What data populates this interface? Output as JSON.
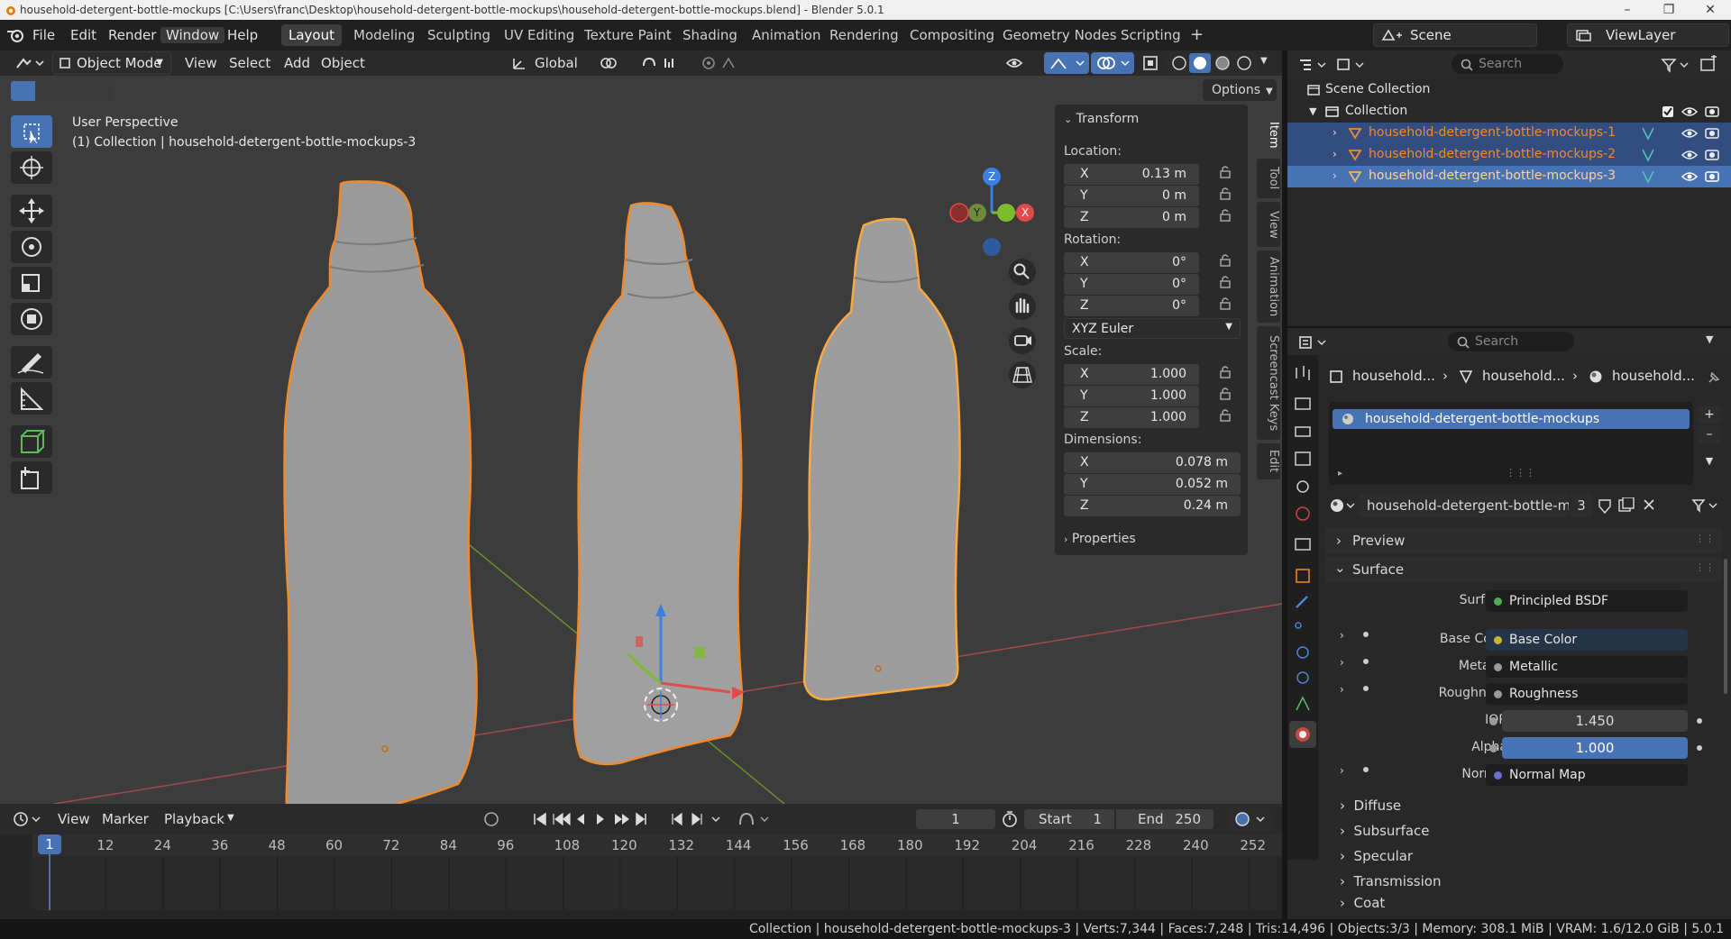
{
  "window": {
    "title": "household-detergent-bottle-mockups [C:\\Users\\franc\\Desktop\\household-detergent-bottle-mockups\\household-detergent-bottle-mockups.blend] - Blender 5.0.1"
  },
  "menu": [
    "File",
    "Edit",
    "Render",
    "Window",
    "Help"
  ],
  "workspaces": [
    {
      "label": "Layout",
      "active": true
    },
    {
      "label": "Modeling"
    },
    {
      "label": "Sculpting"
    },
    {
      "label": "UV Editing"
    },
    {
      "label": "Texture Paint"
    },
    {
      "label": "Shading"
    },
    {
      "label": "Animation"
    },
    {
      "label": "Rendering"
    },
    {
      "label": "Compositing"
    },
    {
      "label": "Geometry Nodes"
    },
    {
      "label": "Scripting"
    }
  ],
  "scene": {
    "name": "Scene",
    "view_layer": "ViewLayer"
  },
  "viewport_header": {
    "mode": "Object Mode",
    "menus": [
      "View",
      "Select",
      "Add",
      "Object"
    ],
    "orientation": "Global",
    "options": "Options"
  },
  "viewport": {
    "perspective": "User Perspective",
    "collection_info": "(1) Collection | household-detergent-bottle-mockups-3",
    "gizmo_axes": [
      "X",
      "Y",
      "Z"
    ]
  },
  "transform": {
    "title": "Transform",
    "location_label": "Location:",
    "location": [
      {
        "axis": "X",
        "value": "0.13 m"
      },
      {
        "axis": "Y",
        "value": "0 m"
      },
      {
        "axis": "Z",
        "value": "0 m"
      }
    ],
    "rotation_label": "Rotation:",
    "rotation": [
      {
        "axis": "X",
        "value": "0°"
      },
      {
        "axis": "Y",
        "value": "0°"
      },
      {
        "axis": "Z",
        "value": "0°"
      }
    ],
    "rotation_mode": "XYZ Euler",
    "scale_label": "Scale:",
    "scale": [
      {
        "axis": "X",
        "value": "1.000"
      },
      {
        "axis": "Y",
        "value": "1.000"
      },
      {
        "axis": "Z",
        "value": "1.000"
      }
    ],
    "dimensions_label": "Dimensions:",
    "dimensions": [
      {
        "axis": "X",
        "value": "0.078 m"
      },
      {
        "axis": "Y",
        "value": "0.052 m"
      },
      {
        "axis": "Z",
        "value": "0.24 m"
      }
    ],
    "properties_label": "Properties"
  },
  "sidebar_tabs": [
    "Item",
    "Tool",
    "View",
    "Animation",
    "Screencast Keys",
    "Edit"
  ],
  "timeline": {
    "menus": [
      "View",
      "Marker",
      "Playback"
    ],
    "current_frame": "1",
    "start_label": "Start",
    "start": "1",
    "end_label": "End",
    "end": "250",
    "ticks": [
      "1",
      "12",
      "24",
      "36",
      "48",
      "60",
      "72",
      "84",
      "96",
      "108",
      "120",
      "132",
      "144",
      "156",
      "168",
      "180",
      "192",
      "204",
      "216",
      "228",
      "240",
      "252"
    ]
  },
  "outliner": {
    "search_placeholder": "Search",
    "scene_collection": "Scene Collection",
    "collection": "Collection",
    "objects": [
      {
        "name": "household-detergent-bottle-mockups-1",
        "selected": true
      },
      {
        "name": "household-detergent-bottle-mockups-2",
        "selected": true
      },
      {
        "name": "household-detergent-bottle-mockups-3",
        "active": true
      }
    ]
  },
  "properties": {
    "search_placeholder": "Search",
    "breadcrumb": [
      "household...",
      "household...",
      "household..."
    ],
    "material_slot": "household-detergent-bottle-mockups",
    "material_name": "household-detergent-bottle-mock...",
    "user_count": "3",
    "sections": {
      "preview": "Preview",
      "surface": "Surface",
      "collapsed": [
        "Diffuse",
        "Subsurface",
        "Specular",
        "Transmission",
        "Coat"
      ]
    },
    "surface_rows": [
      {
        "label": "Surface",
        "value": "Principled BSDF",
        "dot": "#4caf50"
      },
      {
        "label": "Base Color",
        "value": "Base Color",
        "dot": "#c7b52e"
      },
      {
        "label": "Metallic",
        "value": "Metallic",
        "dot": "#9a9a9a"
      },
      {
        "label": "Roughness",
        "value": "Roughness",
        "dot": "#9a9a9a"
      },
      {
        "label": "IOR",
        "value": "1.450",
        "dot": "#9a9a9a"
      },
      {
        "label": "Alpha",
        "value": "1.000",
        "dot": "#9a9a9a"
      },
      {
        "label": "Normal",
        "value": "Normal Map",
        "dot": "#6c6cd8"
      }
    ]
  },
  "status": {
    "text": "Collection | household-detergent-bottle-mockups-3 | Verts:7,344 | Faces:7,248 | Tris:14,496 | Objects:3/3 | Memory: 308.1 MiB | VRAM: 1.6/12.0 GiB | 5.0.1"
  },
  "colors": {
    "accent": "#4772b3",
    "selection_outline": "#f08a2c",
    "axis_x": "#e04a4a",
    "axis_y": "#7cbd2d",
    "axis_z": "#3d7fe0"
  }
}
